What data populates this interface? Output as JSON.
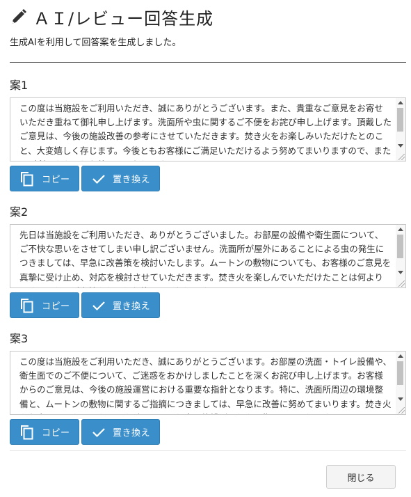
{
  "dialog": {
    "title": "ＡＩ/レビュー回答生成",
    "subtitle": "生成AIを利用して回答案を生成しました。",
    "close_label": "閉じる"
  },
  "proposals": [
    {
      "label": "案1",
      "text": "この度は当施設をご利用いただき、誠にありがとうございます。また、貴重なご意見をお寄せいただき重ねて御礼申し上げます。洗面所や虫に関するご不便をお詫び申し上げます。頂戴したご意見は、今後の施設改善の参考にさせていただきます。焚き火をお楽しみいただけたとのこと、大変嬉しく存じます。今後ともお客様にご満足いただけるよう努めてまいりますので、またのご利用を心よりお待ちしております。",
      "copy_label": "コピー",
      "replace_label": "置き換え"
    },
    {
      "label": "案2",
      "text": "先日は当施設をご利用いただき、ありがとうございました。お部屋の設備や衛生面について、ご不快な思いをさせてしまい申し訳ございません。洗面所が屋外にあることによる虫の発生につきましては、早急に改善策を検討いたします。ムートンの敷物についても、お客様のご意見を真摯に受け止め、対応を検討させていただきます。焚き火を楽しんでいただけたことは何よりです。またのご来館を心よりお待ちしております。",
      "copy_label": "コピー",
      "replace_label": "置き換え"
    },
    {
      "label": "案3",
      "text": "この度は当施設をご利用いただき、誠にありがとうございます。お部屋の洗面・トイレ設備や、衛生面でのご不便について、ご迷惑をおかけしましたことを深くお詫び申し上げます。お客様からのご意見は、今後の施設運営における重要な指針となります。特に、洗面所周辺の環境整備と、ムートンの敷物に関するご指摘につきましては、早急に改善に努めてまいります。焚き火をお楽しみいただけたことを励みに、より良い施設づくりを目指してまいります。",
      "copy_label": "コピー",
      "replace_label": "置き換え"
    }
  ],
  "colors": {
    "primary_button": "#3a8fcb",
    "primary_button_text": "#ffffff",
    "close_button_bg": "#f4f4f4"
  },
  "icons": {
    "title": "pencil-icon",
    "copy": "copy-icon",
    "replace": "check-icon"
  }
}
